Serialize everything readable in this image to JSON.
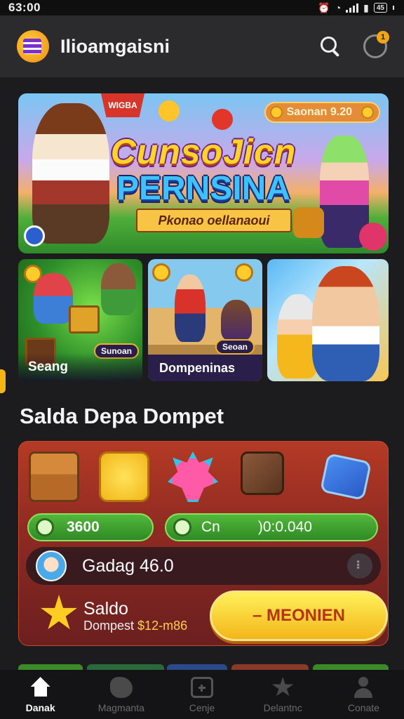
{
  "status_bar": {
    "time": "63:00",
    "battery": "45"
  },
  "header": {
    "app_title": "Ilioamgaisni",
    "notification_count": "1"
  },
  "banner": {
    "tag": "WIGBA",
    "pill_text": "Saonan 9.20",
    "title_line1": "CunsoJicn",
    "title_line2": "PERNSINA",
    "ribbon": "Pkonao oellanaoui"
  },
  "cards": [
    {
      "label": "Seang",
      "chip": "Sunoan"
    },
    {
      "label": "Dompeninas",
      "chip": "Seoan"
    },
    {
      "label": ""
    }
  ],
  "wallet": {
    "section_title": "Salda Depa Dompet",
    "bar1_value": "3600",
    "bar2_unit": "Cn",
    "bar2_value": ")0:0.040",
    "gadget_text": "Gadag 46.0",
    "more_icon": "⠇",
    "saldo_label": "Saldo",
    "saldo_sub_label": "Dompest",
    "saldo_sub_value": "$12-m86",
    "cta_label": "–  MEONIEN"
  },
  "bottom_nav": [
    {
      "label": "Danak",
      "icon": "home-icon",
      "active": true
    },
    {
      "label": "Magmanta",
      "icon": "game-icon",
      "active": false
    },
    {
      "label": "Cenje",
      "icon": "plus-icon",
      "active": false
    },
    {
      "label": "Delantnc",
      "icon": "star-icon",
      "active": false
    },
    {
      "label": "Conate",
      "icon": "user-icon",
      "active": false
    }
  ],
  "colors": {
    "background": "#1c1c1f",
    "header": "#2b2b2e",
    "accent_yellow": "#f5b512",
    "wallet_red": "#b43a25",
    "bar_green": "#52b83a"
  }
}
